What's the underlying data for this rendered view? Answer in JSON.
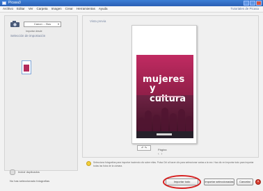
{
  "window": {
    "title": "Picasa3"
  },
  "menubar": {
    "items": [
      "Archivo",
      "Editar",
      "Ver",
      "Carpeta",
      "Imagen",
      "Crear",
      "Herramientas",
      "Ayuda"
    ],
    "help_link": "Tutoriales de Picasa"
  },
  "left_panel": {
    "device_select": "Canon ... Bus",
    "device_sub": "Importar desde",
    "heading": "Selección de importación"
  },
  "center_panel": {
    "preview_label": "Vista previa",
    "zoom": "",
    "page_caption": "Página",
    "cover_title_line1": "mujeres",
    "cover_title_line2": "y cultura"
  },
  "bottom": {
    "checkbox_label": "Incluir duplicados",
    "status_line1": "No has seleccionado fotografías",
    "status_line2": "",
    "hint_text": "Selecciona fotografías para importar haciendo clic sobre ellas. Pulsa Ctrl al hacer clic para seleccionar varias a la vez. Haz clic en Importar todo para importar todas las fotos de la cámara.",
    "import_selected_button": "Importar todo",
    "import_all_button": "Importar seleccionadas",
    "cancel_button": "Cancelar"
  },
  "colors": {
    "highlight": "#d72222",
    "cover": "#b42b5b",
    "titlebar": "#2a5fb4"
  }
}
